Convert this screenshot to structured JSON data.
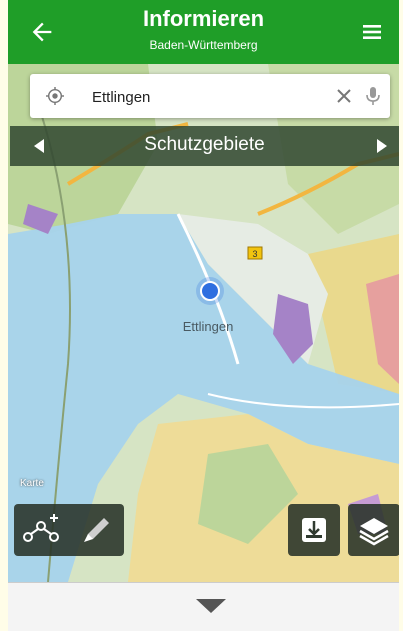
{
  "header": {
    "title": "Informieren",
    "subtitle": "Baden-Württemberg",
    "back_icon": "arrow-left-icon",
    "menu_icon": "hamburger-menu-icon",
    "color": "#1f9e28"
  },
  "search": {
    "value": "Ettlingen",
    "location_icon": "location-pin-icon",
    "clear_icon": "close-icon",
    "mic_icon": "microphone-icon"
  },
  "layer_selector": {
    "label": "Schutzgebiete",
    "prev_icon": "triangle-left-icon",
    "next_icon": "triangle-right-icon"
  },
  "map": {
    "city_label": "Ettlingen",
    "road_badge": "3",
    "small_labels": [
      "Karte"
    ],
    "colors": {
      "water_protection": "#a7d3ec",
      "forest": "#bcd59a",
      "reserve_yellow": "#f1dc95",
      "purple_zone": "#a583c7",
      "location_dot": "#2f6fe0"
    }
  },
  "map_buttons": {
    "measure_icon": "measure-route-icon",
    "draw_icon": "pencil-icon",
    "download_icon": "download-tray-icon",
    "layers_icon": "layers-icon"
  },
  "bottom_panel": {
    "toggle_icon": "chevron-down-icon"
  }
}
